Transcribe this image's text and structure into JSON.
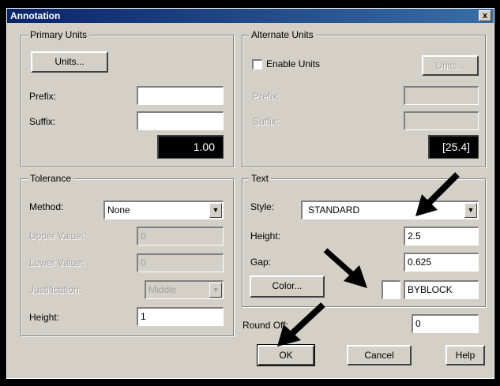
{
  "window": {
    "title": "Annotation",
    "close": "x"
  },
  "primary_units": {
    "title": "Primary Units",
    "units_button": "Units...",
    "prefix_label": "Prefix:",
    "prefix_value": "",
    "suffix_label": "Suffix:",
    "suffix_value": "",
    "preview_value": "1.00"
  },
  "alternate_units": {
    "title": "Alternate Units",
    "enable_label": "Enable Units",
    "units_button": "Units...",
    "prefix_label": "Prefix:",
    "suffix_label": "Suffix:",
    "preview_value": "[25.4]"
  },
  "tolerance": {
    "title": "Tolerance",
    "method_label": "Method:",
    "method_value": "None",
    "upper_label": "Upper Value:",
    "upper_value": "0",
    "lower_label": "Lower Value:",
    "lower_value": "0",
    "justification_label": "Justification:",
    "justification_value": "Middle",
    "height_label": "Height:",
    "height_value": "1"
  },
  "text": {
    "title": "Text",
    "style_label": "Style:",
    "style_value": "STANDARD",
    "height_label": "Height:",
    "height_value": "2.5",
    "gap_label": "Gap:",
    "gap_value": "0.625",
    "color_button": "Color...",
    "color_value": "BYBLOCK"
  },
  "round_off": {
    "label": "Round Off:",
    "value": "0"
  },
  "buttons": {
    "ok": "OK",
    "cancel": "Cancel",
    "help": "Help"
  }
}
